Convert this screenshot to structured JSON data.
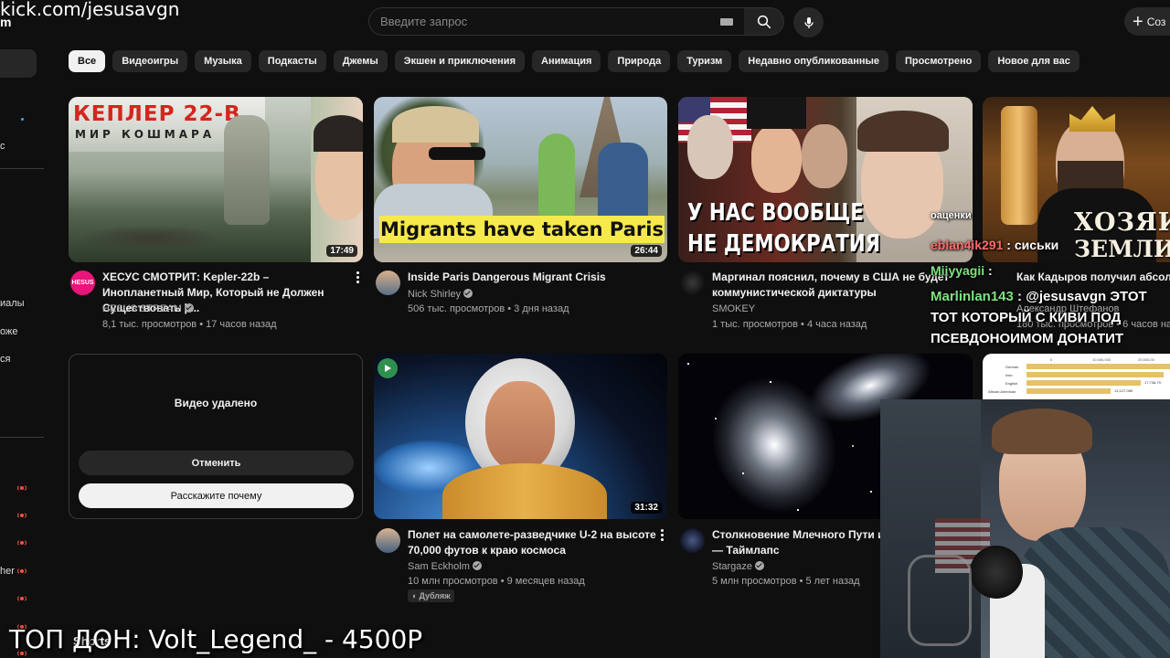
{
  "stream": {
    "url_overlay": "kick.com/jesusavgn",
    "cut_letter": "m",
    "donation": "ТОП ДОН: Volt_Legend_ - 4500Р",
    "shorts_label": "Shorts"
  },
  "header": {
    "search_placeholder": "Введите запрос",
    "create_label": "Соз",
    "icons": [
      "keyboard-icon",
      "search-icon",
      "mic-icon",
      "plus-icon"
    ]
  },
  "sidebar": {
    "fragments": [
      "с",
      "иалы",
      "оже",
      "ся",
      "her"
    ]
  },
  "chips": [
    "Все",
    "Видеоигры",
    "Музыка",
    "Подкасты",
    "Джемы",
    "Экшен и приключения",
    "Анимация",
    "Природа",
    "Туризм",
    "Недавно опубликованные",
    "Просмотрено",
    "Новое для вас"
  ],
  "videos": [
    {
      "thumb_text_1": "КЕПЛЕР 22-В",
      "thumb_text_2": "МИР КОШМАРА",
      "duration": "17:49",
      "avatar_text": "HESUS",
      "title": "ХЕСУС СМОТРИТ: Kepler-22b – Инопланетный Мир, Который не Должен Существовать | ...",
      "channel": "HESUS STREAM",
      "meta": "8,1 тыс. просмотров • 17 часов назад"
    },
    {
      "thumb_text_1": "Migrants have taken Paris",
      "duration": "26:44",
      "title": "Inside Paris Dangerous Migrant Crisis",
      "channel": "Nick Shirley",
      "meta": "506 тыс. просмотров • 3 дня назад"
    },
    {
      "thumb_text_1": "У НАС ВООБЩЕ",
      "thumb_text_2": "НЕ ДЕМОКРАТИЯ",
      "title": "Маргинал пояснил, почему в США не будет коммунистической диктатуры",
      "channel": "SMOKEY",
      "meta": "1 тыс. просмотров • 4 часа назад"
    },
    {
      "thumb_text_1": "ХОЗЯИ",
      "thumb_text_2": "ЗЕМЛИ РУСС",
      "title": "Как Кадыров получил абсол",
      "channel": "Александр Штефанов",
      "meta": "180 тыс. просмотров • 6 часов на"
    },
    {
      "duration": "31:32",
      "title": "Полет на самолете-разведчике U-2 на высоте 70,000 футов к краю космоса",
      "channel": "Sam Eckholm",
      "meta": "10 млн просмотров • 9 месяцев назад",
      "badge": "Дубляж"
    },
    {
      "title": "Столкновение Млечного Пути и — Таймлапс",
      "channel": "Stargaze",
      "meta": "5 млн просмотров • 5 лет назад"
    }
  ],
  "removed_card": {
    "title": "Видео удалено",
    "undo": "Отменить",
    "why": "Расскажите почему"
  },
  "chart_thumb": {
    "rows": [
      "German",
      "Irish",
      "English",
      "African American"
    ],
    "top_ticks": [
      "0",
      "10,000,000",
      "20,000,00"
    ],
    "values": [
      "17,736,79",
      "13,127,085"
    ]
  },
  "chat": [
    {
      "user": "",
      "text": "оаценки"
    },
    {
      "user": "eblan4ik291",
      "text": "сиськи",
      "color": "red"
    },
    {
      "user": "Miiyyagii",
      "text": "",
      "color": "green"
    },
    {
      "user": "Marlinlan143",
      "text": "@jesusavgn ЭТОТ"
    },
    {
      "user": "",
      "text": "ТОТ КОТОРЫЙ С КИВИ ПОД"
    },
    {
      "user": "",
      "text": "ПСЕВДОНОИМОМ ДОНАТИТ"
    }
  ]
}
